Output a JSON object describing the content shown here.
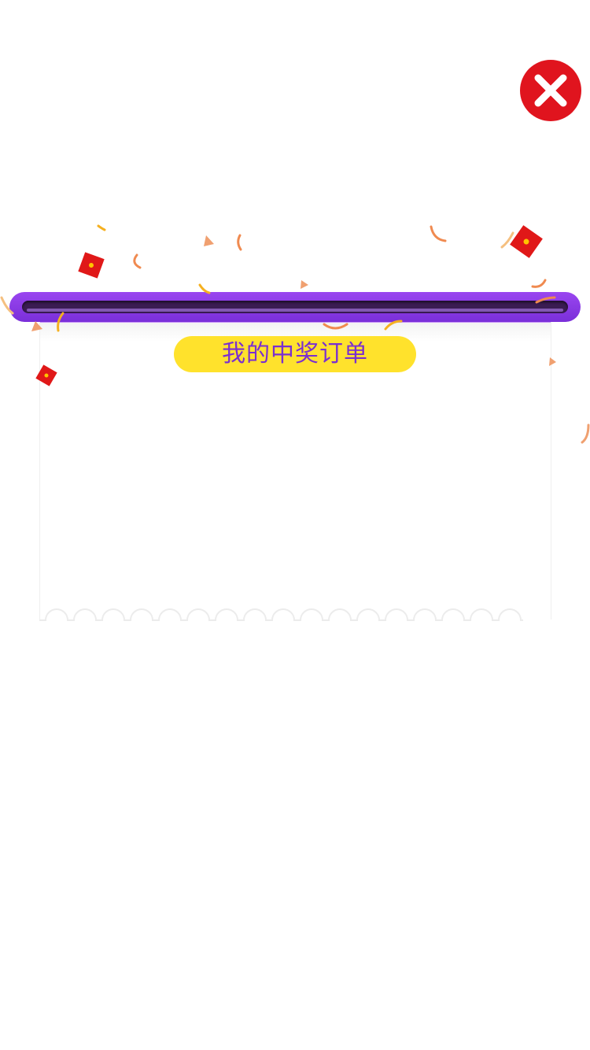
{
  "dialog": {
    "title": "我的中奖订单",
    "close_icon": "close-x-icon"
  },
  "colors": {
    "close_red": "#e0141e",
    "slot_purple": "#8a3ce6",
    "ticket_top_purple": "#c996f8",
    "title_bg_yellow": "#ffe22c",
    "title_text_purple": "#7a2fd0"
  },
  "decorations": {
    "confetti": "confetti-icon",
    "red_envelope": "red-envelope-icon"
  }
}
